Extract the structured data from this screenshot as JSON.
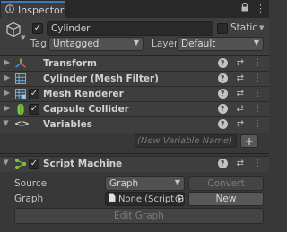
{
  "tab": {
    "label": "Inspector",
    "icon": "info-icon",
    "lock_icon": "lock-icon",
    "menu_icon": "kebab-menu-icon"
  },
  "gameobject": {
    "name": "Cylinder",
    "active": true,
    "static_label": "Static",
    "tag_label": "Tag",
    "tag_value": "Untagged",
    "layer_label": "Layer",
    "layer_value": "Default"
  },
  "components": [
    {
      "title": "Transform",
      "icon": "transform-axes-icon",
      "has_checkbox": false
    },
    {
      "title": "Cylinder (Mesh Filter)",
      "icon": "mesh-grid-icon",
      "has_checkbox": false
    },
    {
      "title": "Mesh Renderer",
      "icon": "mesh-renderer-icon",
      "has_checkbox": true,
      "enabled": true
    },
    {
      "title": "Capsule Collider",
      "icon": "capsule-icon",
      "has_checkbox": true,
      "enabled": true
    },
    {
      "title": "Variables",
      "icon": "code-brackets-icon",
      "has_checkbox": false
    }
  ],
  "variables": {
    "placeholder": "(New Variable Name)",
    "add_label": "+"
  },
  "script_machine": {
    "title": "Script Machine",
    "enabled": true,
    "source_label": "Source",
    "source_value": "Graph",
    "convert_label": "Convert",
    "graph_label": "Graph",
    "graph_value": "None (Script G",
    "new_label": "New",
    "edit_graph_label": "Edit Graph"
  },
  "colors": {
    "accent": "#3a79bb",
    "background": "#383838",
    "header": "#3e3e3e"
  }
}
